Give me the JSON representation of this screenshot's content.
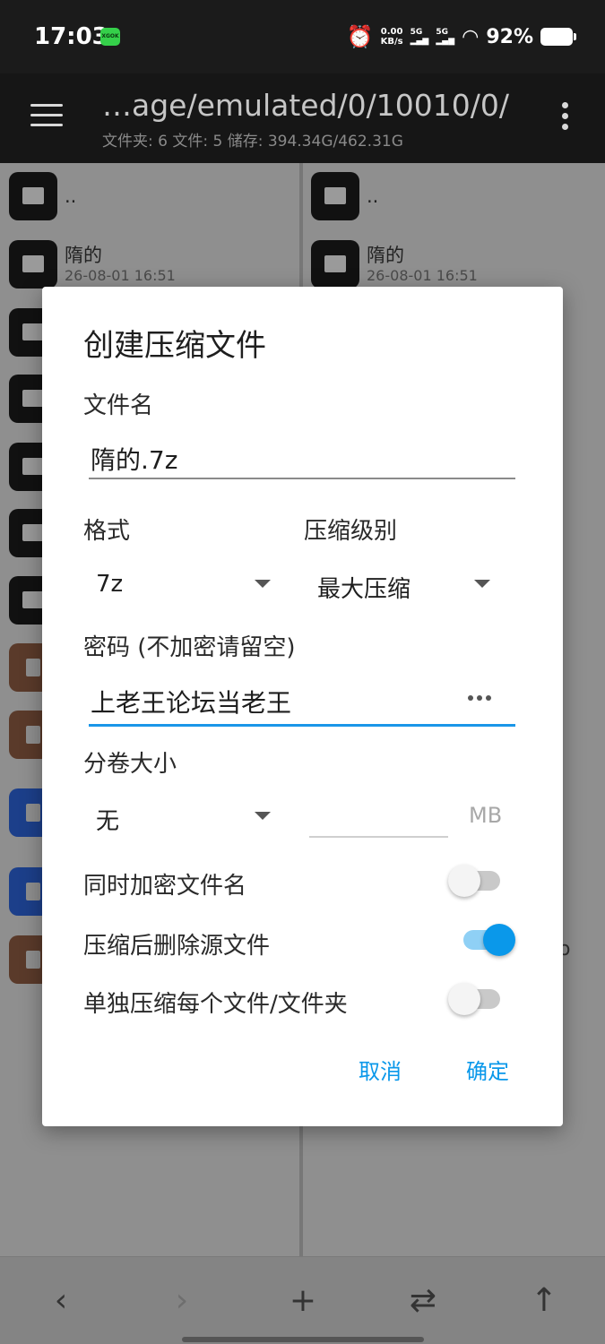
{
  "status": {
    "time": "17:03",
    "badge": "XGOK",
    "net_speed_value": "0.00",
    "net_speed_unit": "KB/s",
    "sim1": "5G",
    "sim2": "5G",
    "battery": "92%"
  },
  "appbar": {
    "path": "…age/emulated/0/10010/0/",
    "summary": "文件夹: 6  文件: 5  储存: 394.34G/462.31G"
  },
  "left_pane": {
    "items": [
      {
        "name": "..",
        "date": ""
      },
      {
        "name": "隋的",
        "date": "26-08-01 16:51"
      }
    ]
  },
  "right_pane": {
    "items": [
      {
        "name": "..",
        "date": ""
      },
      {
        "name": "隋的",
        "date": "26-08-01 16:51"
      }
    ],
    "partial_text": "o"
  },
  "dialog": {
    "title": "创建压缩文件",
    "filename_label": "文件名",
    "filename_value": "隋的.7z",
    "format_label": "格式",
    "format_value": "7z",
    "level_label": "压缩级别",
    "level_value": "最大压缩",
    "password_label": "密码 (不加密请留空)",
    "password_value": "上老王论坛当老王",
    "volume_label": "分卷大小",
    "volume_value": "无",
    "volume_unit": "MB",
    "opt_encrypt_names": {
      "label": "同时加密文件名",
      "checked": false
    },
    "opt_delete_source": {
      "label": "压缩后删除源文件",
      "checked": true
    },
    "opt_separate": {
      "label": "单独压缩每个文件/文件夹",
      "checked": false
    },
    "cancel": "取消",
    "confirm": "确定"
  },
  "toolbar": {
    "back": "‹",
    "forward": "›",
    "add": "+",
    "swap": "⇄",
    "up": "↑"
  },
  "colors": {
    "accent": "#0a98ea",
    "appbar": "#161616",
    "dim_overlay": "#8f8f8f"
  }
}
